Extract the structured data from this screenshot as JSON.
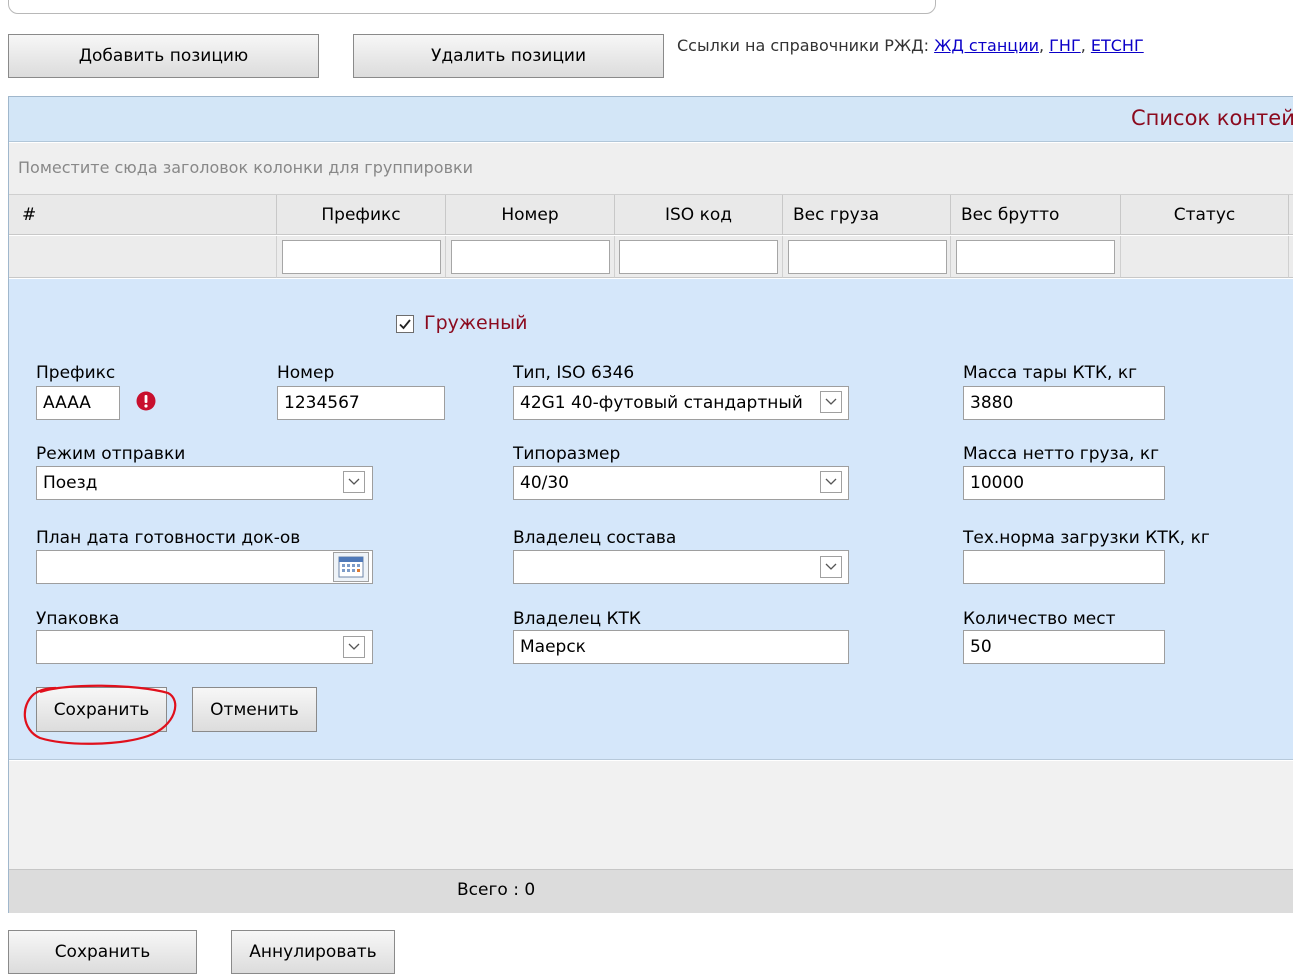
{
  "toolbar": {
    "add_position": "Добавить позицию",
    "delete_positions": "Удалить позиции",
    "links_prefix": "Ссылки на справочники РЖД:",
    "links": [
      "ЖД станции",
      "ГНГ",
      "ЕТСНГ"
    ]
  },
  "grid": {
    "title": "Список контей",
    "group_hint": "Поместите сюда заголовок колонки для группировки",
    "columns": [
      "#",
      "Префикс",
      "Номер",
      "ISO код",
      "Вес груза",
      "Вес брутто",
      "Статус"
    ],
    "total_label": "Всего : 0"
  },
  "form": {
    "loaded_checkbox": {
      "label": "Груженый",
      "checked": true
    },
    "prefix": {
      "label": "Префикс",
      "value": "AAAA"
    },
    "number": {
      "label": "Номер",
      "value": "1234567"
    },
    "iso_type": {
      "label": "Тип, ISO 6346",
      "value": "42G1 40-футовый стандартный"
    },
    "tare_mass": {
      "label": "Масса тары КТК, кг",
      "value": "3880"
    },
    "send_mode": {
      "label": "Режим отправки",
      "value": "Поезд"
    },
    "size_type": {
      "label": "Типоразмер",
      "value": "40/30"
    },
    "net_mass": {
      "label": "Масса нетто груза, кг",
      "value": "10000"
    },
    "plan_date": {
      "label": "План дата готовности док-ов",
      "value": ""
    },
    "train_owner": {
      "label": "Владелец состава",
      "value": ""
    },
    "tech_norm": {
      "label": "Тех.норма загрузки КТК, кг",
      "value": ""
    },
    "packaging": {
      "label": "Упаковка",
      "value": ""
    },
    "ktk_owner": {
      "label": "Владелец КТК",
      "value": "Маерск"
    },
    "places_count": {
      "label": "Количество мест",
      "value": "50"
    },
    "save_button": "Сохранить",
    "cancel_button": "Отменить"
  },
  "bottom": {
    "save_button": "Сохранить",
    "annul_button": "Аннулировать"
  },
  "colors": {
    "title_text": "#8b0a1e",
    "edit_background": "#d5e7fa",
    "link": "#0b00c8",
    "error_icon": "#c8102e",
    "highlight_circle": "#e0101c"
  }
}
